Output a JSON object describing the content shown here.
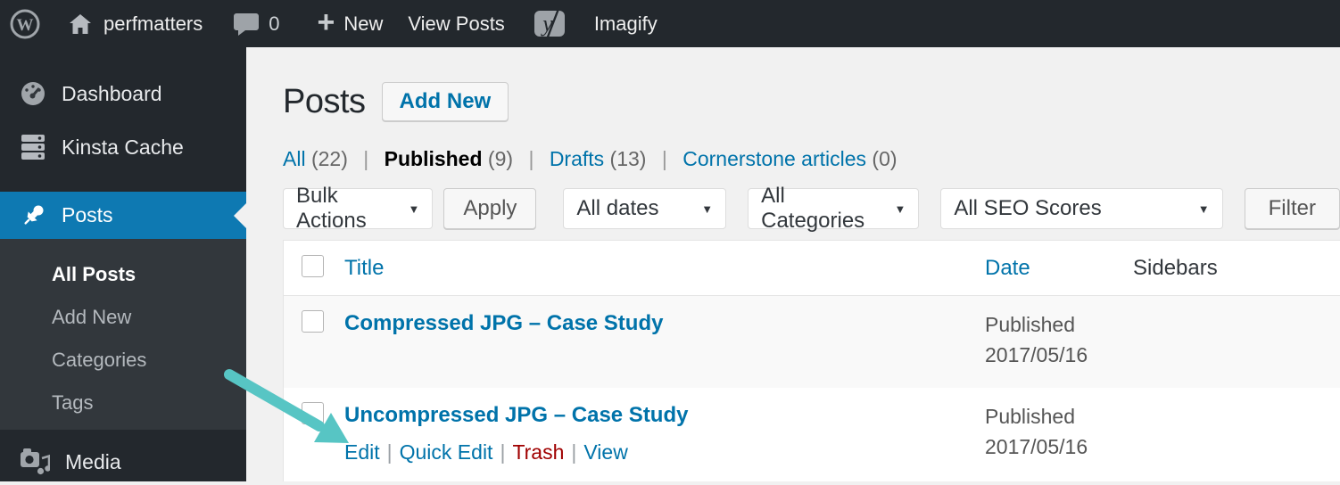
{
  "admin_bar": {
    "wp_logo_letter": "W",
    "site_name": "perfmatters",
    "comments_count": "0",
    "new_plus": "+",
    "new_label": "New",
    "view_posts_label": "View Posts",
    "yoast_letter": "y",
    "imagify_label": "Imagify"
  },
  "sidebar": {
    "dashboard_label": "Dashboard",
    "kinsta_cache_label": "Kinsta Cache",
    "posts_label": "Posts",
    "media_label": "Media",
    "posts_submenu": {
      "all_posts": "All Posts",
      "add_new": "Add New",
      "categories": "Categories",
      "tags": "Tags"
    }
  },
  "main": {
    "page_title": "Posts",
    "add_new_button": "Add New",
    "separator": "|",
    "views": [
      {
        "label": "All",
        "count": "(22)"
      },
      {
        "label": "Published",
        "count": "(9)"
      },
      {
        "label": "Drafts",
        "count": "(13)"
      },
      {
        "label": "Cornerstone articles",
        "count": "(0)"
      }
    ],
    "toolbar": {
      "bulk_actions_value": "Bulk Actions",
      "apply_button": "Apply",
      "dates_value": "All dates",
      "categories_value": "All Categories",
      "seo_scores_value": "All SEO Scores",
      "filter_button": "Filter",
      "dropdown_arrow": "▼"
    },
    "table": {
      "columns": {
        "title": "Title",
        "date": "Date",
        "sidebars": "Sidebars"
      },
      "rows": [
        {
          "title": "Compressed JPG – Case Study",
          "status": "Published",
          "date": "2017/05/16"
        },
        {
          "title": "Uncompressed JPG – Case Study",
          "status": "Published",
          "date": "2017/05/16",
          "actions": {
            "edit": "Edit",
            "quick_edit": "Quick Edit",
            "trash": "Trash",
            "view": "View"
          }
        }
      ]
    }
  },
  "colors": {
    "admin_dark": "#23282d",
    "submenu_bg": "#32373c",
    "menu_active_bg": "#0e79b2",
    "accent_blue": "#0073aa",
    "trash_red": "#a00000",
    "arrow_teal": "#57c5c4",
    "page_bg": "#f1f1f1",
    "stripe_bg": "#f9f9f9"
  }
}
